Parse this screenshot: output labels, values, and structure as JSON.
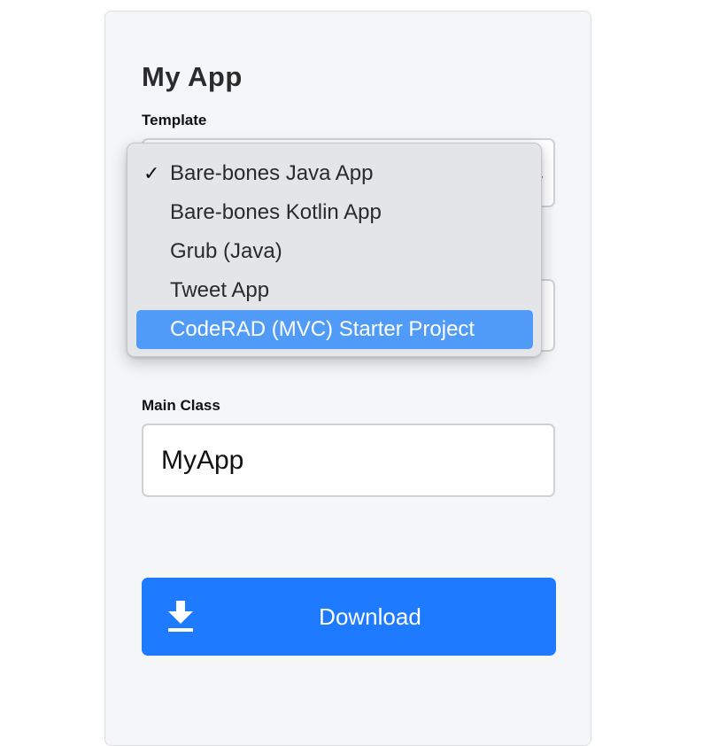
{
  "app": {
    "title": "My App"
  },
  "template_field": {
    "label": "Template",
    "selected": "Bare-bones Java App",
    "options": [
      "Bare-bones Java App",
      "Bare-bones Kotlin App",
      "Grub (Java)",
      "Tweet App",
      "CodeRAD (MVC) Starter Project"
    ],
    "checkmark": "✓",
    "highlighted_index": 4
  },
  "main_class_field": {
    "label": "Main Class",
    "value": "MyApp"
  },
  "download_button": {
    "label": "Download",
    "icon": "download-icon"
  },
  "colors": {
    "accent": "#1e7bff",
    "highlight": "#4f9bf7"
  }
}
